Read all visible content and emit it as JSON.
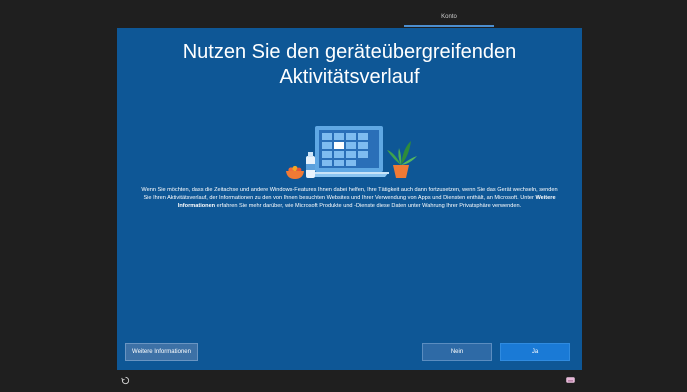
{
  "top": {
    "tab_label": "Konto"
  },
  "dialog": {
    "title": "Nutzen Sie den geräteübergreifenden Aktivitätsverlauf",
    "body_part1": "Wenn Sie möchten, dass die Zeitachse und andere Windows-Features Ihnen dabei helfen, Ihre Tätigkeit auch dann fortzusetzen, wenn Sie das Gerät wechseln, senden Sie Ihren Aktivitätsverlauf, der Informationen zu den von Ihnen besuchten Websites und Ihrer Verwendung von Apps und Diensten enthält, an Microsoft. Unter ",
    "body_bold": "Weitere Informationen",
    "body_part2": " erfahren Sie mehr darüber, wie Microsoft Produkte und -Dienste diese Daten unter Wahrung Ihrer Privatsphäre verwenden.",
    "more_info_button": "Weitere Informationen",
    "no_button": "Nein",
    "yes_button": "Ja"
  },
  "icons": {
    "accessibility": "accessibility-icon",
    "keyboard": "keyboard-icon",
    "illustration": "laptop-timeline-illustration"
  },
  "colors": {
    "background": "#1f1f1f",
    "panel": "#0e5796",
    "yes_button": "#1a7ad6",
    "no_button": "#2e6aa6",
    "more_button": "#3d71a6"
  }
}
